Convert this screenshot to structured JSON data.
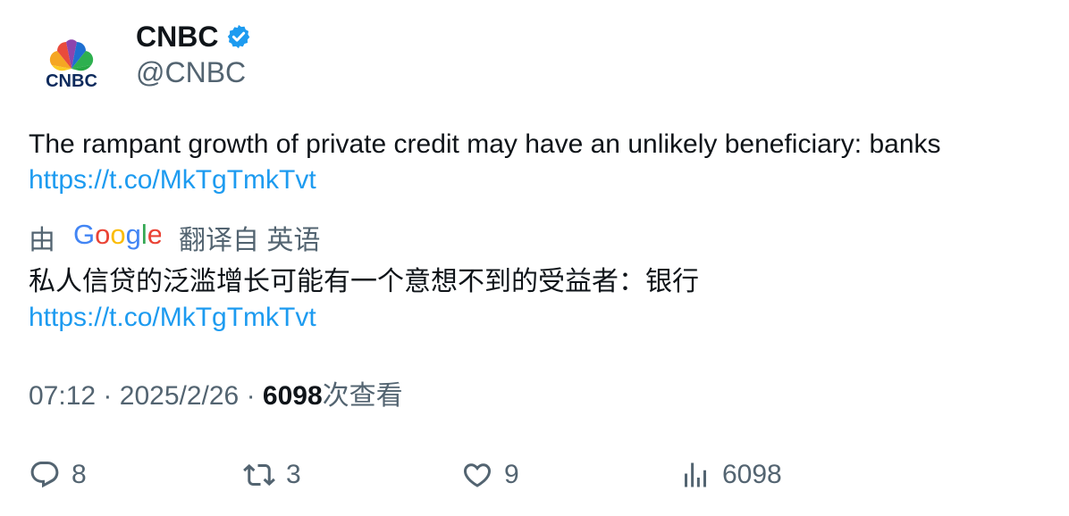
{
  "author": {
    "display_name": "CNBC",
    "handle": "@CNBC",
    "avatar_icon": "cnbc-peacock-logo",
    "avatar_logo_text": "CNBC",
    "verified": true,
    "verified_color": "#1d9bf0"
  },
  "tweet": {
    "text": "The rampant growth of private credit may have an unlikely beneficiary: banks",
    "link": "https://t.co/MkTgTmkTvt"
  },
  "translation": {
    "prefix": "由",
    "provider": "Google",
    "suffix": "翻译自 英语",
    "text": "私人信贷的泛滥增长可能有一个意想不到的受益者：银行",
    "link": "https://t.co/MkTgTmkTvt"
  },
  "meta": {
    "time": "07:12",
    "date": "2025/2/26",
    "separator": "·",
    "views_count": "6098",
    "views_label": "次查看"
  },
  "actions": {
    "replies": "8",
    "retweets": "3",
    "likes": "9",
    "views": "6098"
  },
  "colors": {
    "text": "#0f1419",
    "secondary": "#536471",
    "link": "#1d9bf0"
  }
}
